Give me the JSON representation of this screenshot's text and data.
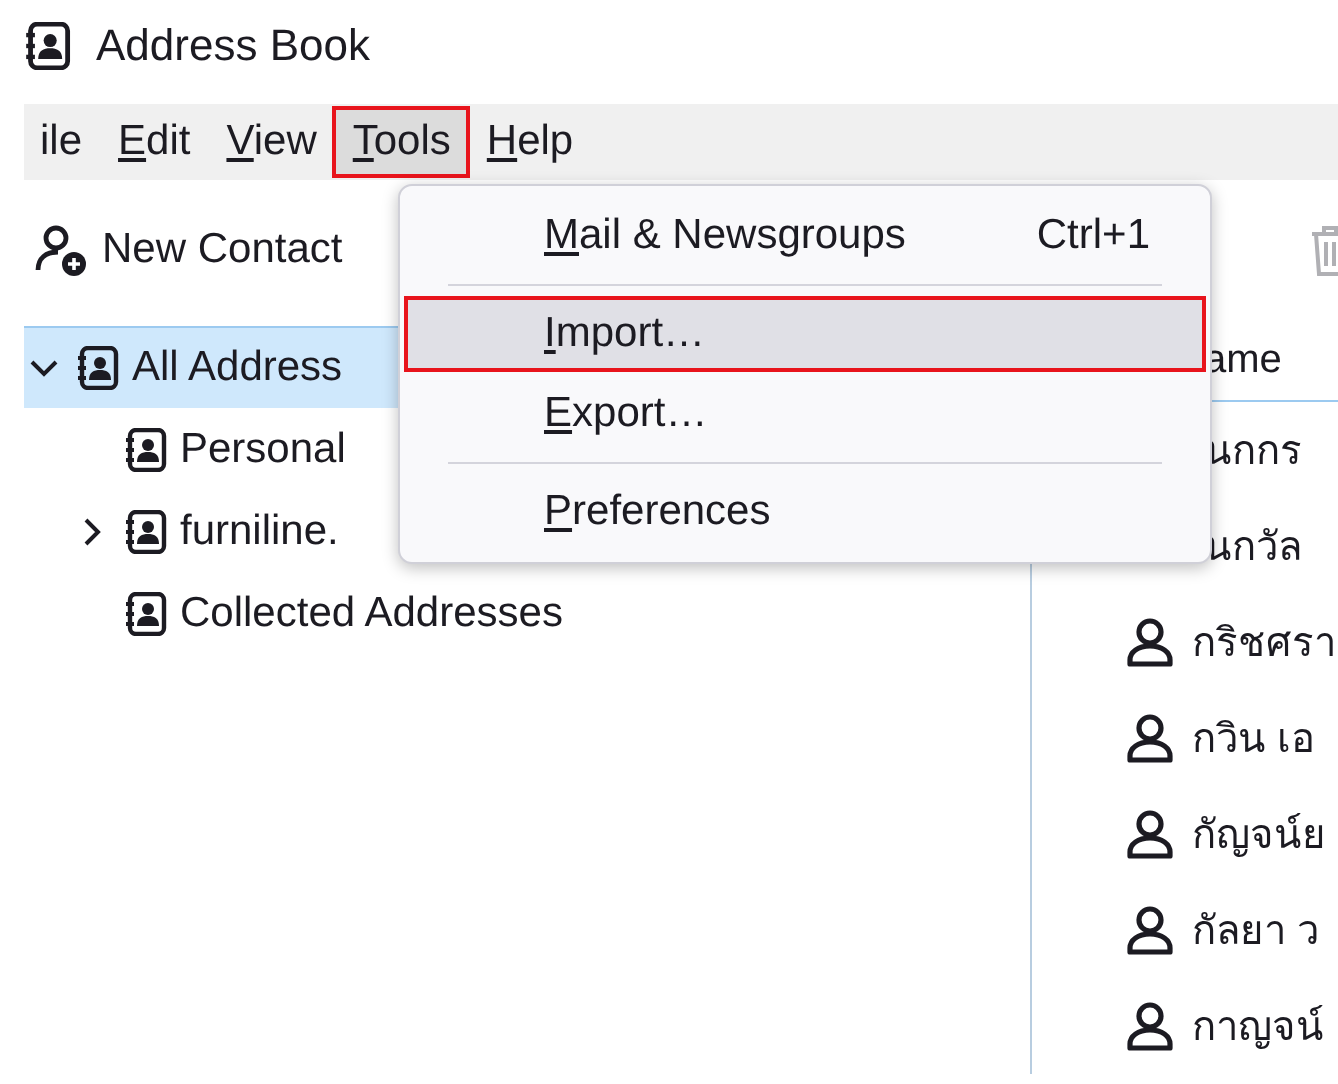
{
  "window": {
    "title": "Address Book"
  },
  "menubar": [
    {
      "rest": "ile",
      "selected": false,
      "highlighted": false
    },
    {
      "accel": "E",
      "rest": "dit",
      "selected": false,
      "highlighted": false
    },
    {
      "accel": "V",
      "rest": "iew",
      "selected": false,
      "highlighted": false
    },
    {
      "accel": "T",
      "rest": "ools",
      "selected": true,
      "highlighted": true
    },
    {
      "accel": "H",
      "rest": "elp",
      "selected": false,
      "highlighted": false
    }
  ],
  "toolbar": {
    "new_contact": "New Contact"
  },
  "tree": [
    {
      "label": "All Address",
      "selected": true,
      "expanded": true,
      "children": [
        {
          "label": "Personal",
          "selected": false
        },
        {
          "label": "furniline.",
          "selected": false,
          "expanded": false
        },
        {
          "label": "Collected Addresses",
          "selected": false
        }
      ]
    }
  ],
  "contacts": {
    "column_1": "ame",
    "rows": [
      {
        "name": "นกกร",
        "avatar": false
      },
      {
        "name": "นกวัล",
        "avatar": false
      },
      {
        "name": "กริชศรา",
        "avatar": true
      },
      {
        "name": "กวิน เอ",
        "avatar": true
      },
      {
        "name": "กัญจน์ย",
        "avatar": true
      },
      {
        "name": "กัลยา ว",
        "avatar": true
      },
      {
        "name": "กาญจน์",
        "avatar": true
      }
    ]
  },
  "tools_menu": [
    {
      "kind": "item",
      "accel": "M",
      "rest": "ail & Newsgroups",
      "shortcut": "Ctrl+1",
      "selected": false,
      "highlighted": false
    },
    {
      "kind": "separator"
    },
    {
      "kind": "item",
      "accel": "I",
      "rest": "mport…",
      "selected": true,
      "highlighted": true
    },
    {
      "kind": "item",
      "accel": "E",
      "rest": "xport…",
      "selected": false,
      "highlighted": false
    },
    {
      "kind": "separator"
    },
    {
      "kind": "item",
      "accel": "P",
      "rest": "references",
      "selected": false,
      "highlighted": false
    }
  ]
}
